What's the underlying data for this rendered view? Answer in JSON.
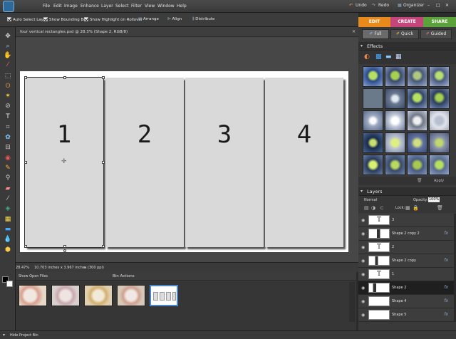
{
  "menu": {
    "items": [
      "File",
      "Edit",
      "Image",
      "Enhance",
      "Layer",
      "Select",
      "Filter",
      "View",
      "Window",
      "Help"
    ],
    "undo": "Undo",
    "redo": "Redo",
    "organizer": "Organizer"
  },
  "options": {
    "auto_select_layer": "Auto Select Layer",
    "show_bounding_box": "Show Bounding Box",
    "show_highlight": "Show Highlight on Rollover",
    "arrange": "Arrange",
    "align": "Align",
    "distribute": "Distribute"
  },
  "modes": {
    "edit": "EDIT",
    "create": "CREATE",
    "share": "SHARE",
    "colors": {
      "edit": "#e8891c",
      "create": "#c3457a",
      "share": "#5da33b"
    }
  },
  "edit_modes": {
    "full": "Full",
    "quick": "Quick",
    "guided": "Guided"
  },
  "document": {
    "title": "four vertical rectangles.psd @ 28.3% (Shape 2, RGB/8)",
    "rects": [
      "1",
      "2",
      "3",
      "4"
    ]
  },
  "status": {
    "zoom": "28.47%",
    "info": "10.703 inches x 3.967 inches (300 ppi)"
  },
  "effects": {
    "header": "Effects",
    "apply": "Apply"
  },
  "layers": {
    "header": "Layers",
    "blend_mode": "Normal",
    "opacity_label": "Opacity:",
    "opacity_value": "100%",
    "lock_label": "Lock:",
    "items": [
      {
        "name": "3",
        "thumb": "T",
        "fx": ""
      },
      {
        "name": "Shape 2 copy 2",
        "thumb": "",
        "fx": "fx"
      },
      {
        "name": "2",
        "thumb": "T",
        "fx": ""
      },
      {
        "name": "Shape 2 copy",
        "thumb": "",
        "fx": "fx"
      },
      {
        "name": "1",
        "thumb": "T",
        "fx": ""
      },
      {
        "name": "Shape 2",
        "thumb": "",
        "fx": "fx"
      },
      {
        "name": "Shape 4",
        "thumb": "",
        "fx": "fx"
      },
      {
        "name": "Shape 5",
        "thumb": "",
        "fx": "fx"
      }
    ]
  },
  "bin": {
    "show_open_files": "Show Open Files",
    "bin_actions": "Bin Actions",
    "hide_project_bin": "Hide Project Bin"
  }
}
